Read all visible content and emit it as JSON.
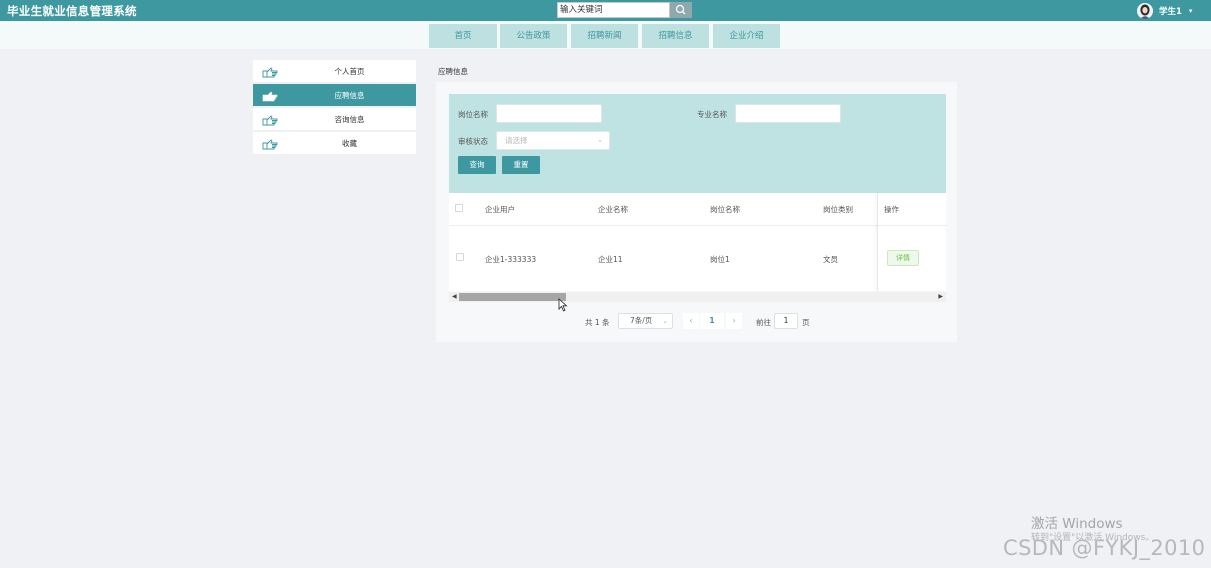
{
  "header": {
    "title": "毕业生就业信息管理系统",
    "search_value": "输入关键词",
    "username": "学生1",
    "colors": {
      "primary": "#3e98a0",
      "tab_bg": "#bde0e0",
      "filter_bg": "#bfe3e2"
    }
  },
  "nav": {
    "items": [
      "首页",
      "公告政策",
      "招聘新闻",
      "招聘信息",
      "企业介绍"
    ]
  },
  "sidebar": {
    "items": [
      {
        "label": "个人首页",
        "active": false
      },
      {
        "label": "应聘信息",
        "active": true
      },
      {
        "label": "咨询信息",
        "active": false
      },
      {
        "label": "收藏",
        "active": false
      }
    ]
  },
  "breadcrumb": "应聘信息",
  "filters": {
    "position_label": "岗位名称",
    "major_label": "专业名称",
    "status_label": "审核状态",
    "status_placeholder": "请选择",
    "query_button": "查询",
    "reset_button": "重置"
  },
  "table": {
    "columns": [
      "企业用户",
      "企业名称",
      "岗位名称",
      "岗位类别",
      "操作"
    ],
    "rows": [
      {
        "cells": [
          "企业1-333333",
          "企业11",
          "岗位1",
          "文员"
        ],
        "action": "详情"
      }
    ]
  },
  "pagination": {
    "total": "共 1 条",
    "page_size": "7条/页",
    "current_page": "1",
    "goto_label": "前往",
    "goto_value": "1",
    "page_suffix": "页"
  },
  "watermark": {
    "windows_title": "激活 Windows",
    "windows_sub": "转到\"设置\"以激活 Windows。",
    "csdn": "CSDN @FYKJ_2010"
  }
}
